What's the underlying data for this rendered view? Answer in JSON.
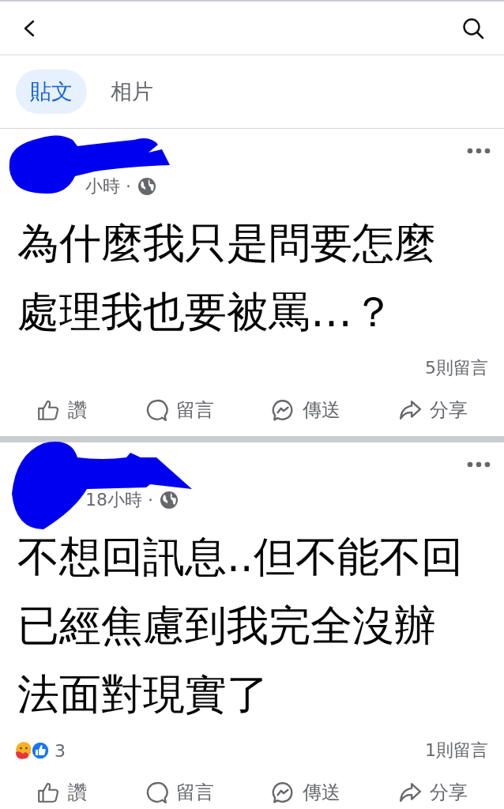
{
  "tabs": [
    {
      "label": "貼文",
      "selected": true
    },
    {
      "label": "相片",
      "selected": false
    }
  ],
  "posts": [
    {
      "time": "小時 ·",
      "text": "為什麼我只是問要怎麼處理我也要被罵…？",
      "comments": "5則留言",
      "actions": [
        {
          "kind": "like",
          "label": "讚"
        },
        {
          "kind": "comment",
          "label": "留言"
        },
        {
          "kind": "send",
          "label": "傳送"
        },
        {
          "kind": "share",
          "label": "分享"
        }
      ]
    },
    {
      "time": "18小時 ·",
      "text": "不想回訊息..但不能不回已經焦慮到我完全沒辦法面對現實了",
      "reactions": "3",
      "comments": "1則留言",
      "actions": [
        {
          "kind": "like",
          "label": "讚"
        },
        {
          "kind": "comment",
          "label": "留言"
        },
        {
          "kind": "send",
          "label": "傳送"
        },
        {
          "kind": "share",
          "label": "分享"
        }
      ]
    }
  ]
}
